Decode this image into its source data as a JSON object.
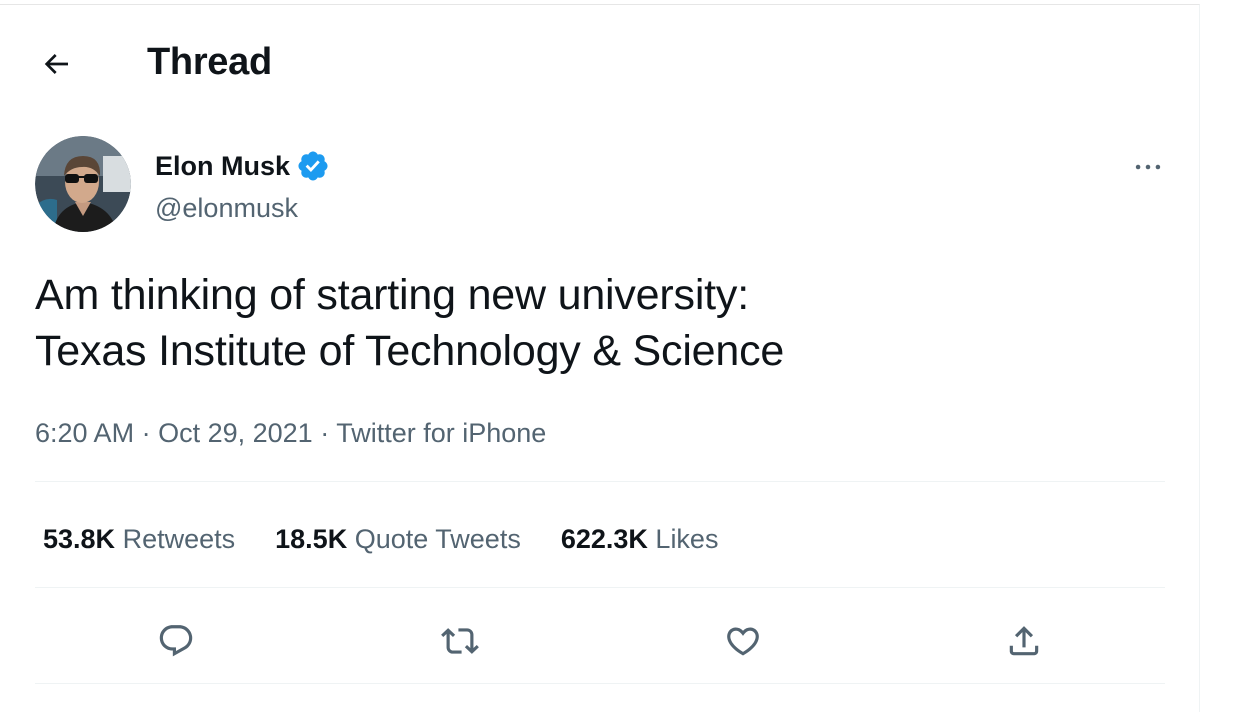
{
  "header": {
    "back_icon": "arrow-left-icon",
    "title": "Thread"
  },
  "tweet": {
    "author": {
      "name": "Elon Musk",
      "handle": "@elonmusk",
      "verified": true,
      "verified_icon": "verified-badge-icon",
      "avatar_icon": "avatar-image"
    },
    "more_icon": "more-horizontal-icon",
    "text_lines": [
      "Am thinking of starting new university:",
      "Texas Institute of Technology & Science"
    ],
    "time": "6:20 AM",
    "date": "Oct 29, 2021",
    "separator": "·",
    "source": "Twitter for iPhone",
    "stats": {
      "retweets": {
        "count": "53.8K",
        "label": "Retweets"
      },
      "quote_tweets": {
        "count": "18.5K",
        "label": "Quote Tweets"
      },
      "likes": {
        "count": "622.3K",
        "label": "Likes"
      }
    },
    "actions": {
      "reply_icon": "reply-icon",
      "retweet_icon": "retweet-icon",
      "like_icon": "heart-icon",
      "share_icon": "share-icon"
    }
  },
  "colors": {
    "text_primary": "#0f1419",
    "text_secondary": "#536471",
    "verified_blue": "#1d9bf0",
    "divider": "#eff3f4"
  }
}
